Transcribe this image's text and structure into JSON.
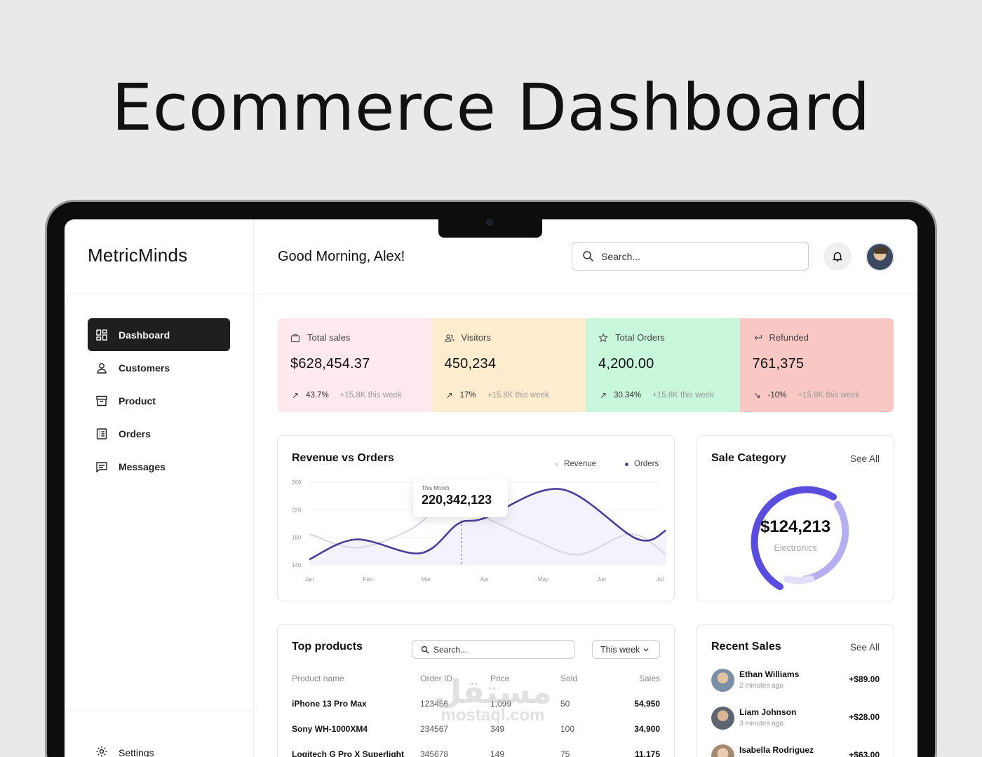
{
  "hero": {
    "title": "Ecommerce Dashboard"
  },
  "brand": {
    "name": "MetricMinds"
  },
  "sidebar": {
    "items": [
      {
        "label": "Dashboard",
        "icon": "dashboard-icon",
        "active": true
      },
      {
        "label": "Customers",
        "icon": "user-icon"
      },
      {
        "label": "Product",
        "icon": "archive-icon"
      },
      {
        "label": "Orders",
        "icon": "list-icon"
      },
      {
        "label": "Messages",
        "icon": "message-icon"
      }
    ],
    "settings_label": "Settings"
  },
  "header": {
    "greeting": "Good Morning, Alex!",
    "search_placeholder": "Search..."
  },
  "stats": [
    {
      "label": "Total sales",
      "icon": "bag-icon",
      "value": "$628,454.37",
      "change": "43.7%",
      "direction": "up",
      "note": "+15.8K this week",
      "color": "#ffe9ee"
    },
    {
      "label": "Visitors",
      "icon": "users-icon",
      "value": "450,234",
      "change": "17%",
      "direction": "up",
      "note": "+15.8K this week",
      "color": "#fdeccd"
    },
    {
      "label": "Total Orders",
      "icon": "star-icon",
      "value": "4,200.00",
      "change": "30.34%",
      "direction": "up",
      "note": "+15.8K this week",
      "color": "#c8f7db"
    },
    {
      "label": "Refunded",
      "icon": "return-icon",
      "value": "761,375",
      "change": "-10%",
      "direction": "down",
      "note": "+15.8K this week",
      "color": "#f9c8c4"
    }
  ],
  "revenue_chart": {
    "title": "Revenue vs Orders",
    "legend": [
      {
        "name": "Revenue",
        "color": "#d9d9df"
      },
      {
        "name": "Orders",
        "color": "#4b3d9a"
      }
    ],
    "tooltip_label": "This Month",
    "tooltip_value": "220,342,123"
  },
  "chart_data": {
    "type": "line",
    "title": "Revenue vs Orders",
    "x": [
      "Jan",
      "Feb",
      "Mar",
      "Apr",
      "May",
      "Jun",
      "Jul"
    ],
    "y_ticks": [
      260,
      220,
      180,
      140
    ],
    "ylim": [
      140,
      260
    ],
    "series": [
      {
        "name": "Orders",
        "color": "#4b3d9a",
        "points": [
          [
            0,
            148
          ],
          [
            0.8,
            177
          ],
          [
            1.9,
            157
          ],
          [
            2.55,
            200
          ],
          [
            3.0,
            208
          ],
          [
            4.3,
            250
          ],
          [
            5.6,
            178
          ],
          [
            6.1,
            190
          ]
        ]
      },
      {
        "name": "Revenue",
        "color": "#d9d9df",
        "points": [
          [
            0,
            185
          ],
          [
            0.8,
            165
          ],
          [
            1.7,
            190
          ],
          [
            2.4,
            230
          ],
          [
            3.1,
            205
          ],
          [
            3.8,
            178
          ],
          [
            4.6,
            155
          ],
          [
            5.5,
            185
          ],
          [
            6.1,
            155
          ]
        ]
      }
    ],
    "grid": true,
    "legend_position": "top-right"
  },
  "sale_category": {
    "title": "Sale Category",
    "see_all": "See All",
    "value": "$124,213",
    "label": "Electronics"
  },
  "top_products": {
    "title": "Top products",
    "search_placeholder": "Search...",
    "filter": "This week",
    "columns": [
      "Product name",
      "Order ID",
      "Price",
      "Sold",
      "Sales"
    ],
    "rows": [
      [
        "iPhone 13 Pro Max",
        "123456",
        "1,099",
        "50",
        "54,950"
      ],
      [
        "Sony WH-1000XM4",
        "234567",
        "349",
        "100",
        "34,900"
      ],
      [
        "Logitech G Pro X Superlight",
        "345678",
        "149",
        "75",
        "11,175"
      ]
    ]
  },
  "recent_sales": {
    "title": "Recent Sales",
    "see_all": "See All",
    "items": [
      {
        "name": "Ethan Williams",
        "time": "2 minutes ago",
        "amount": "+$89.00"
      },
      {
        "name": "Liam Johnson",
        "time": "3 minutes ago",
        "amount": "+$28.00"
      },
      {
        "name": "Isabella Rodriguez",
        "time": "",
        "amount": "+$63.00"
      }
    ]
  },
  "watermark": {
    "arabic": "مستقل",
    "latin": "mostaql.com"
  }
}
